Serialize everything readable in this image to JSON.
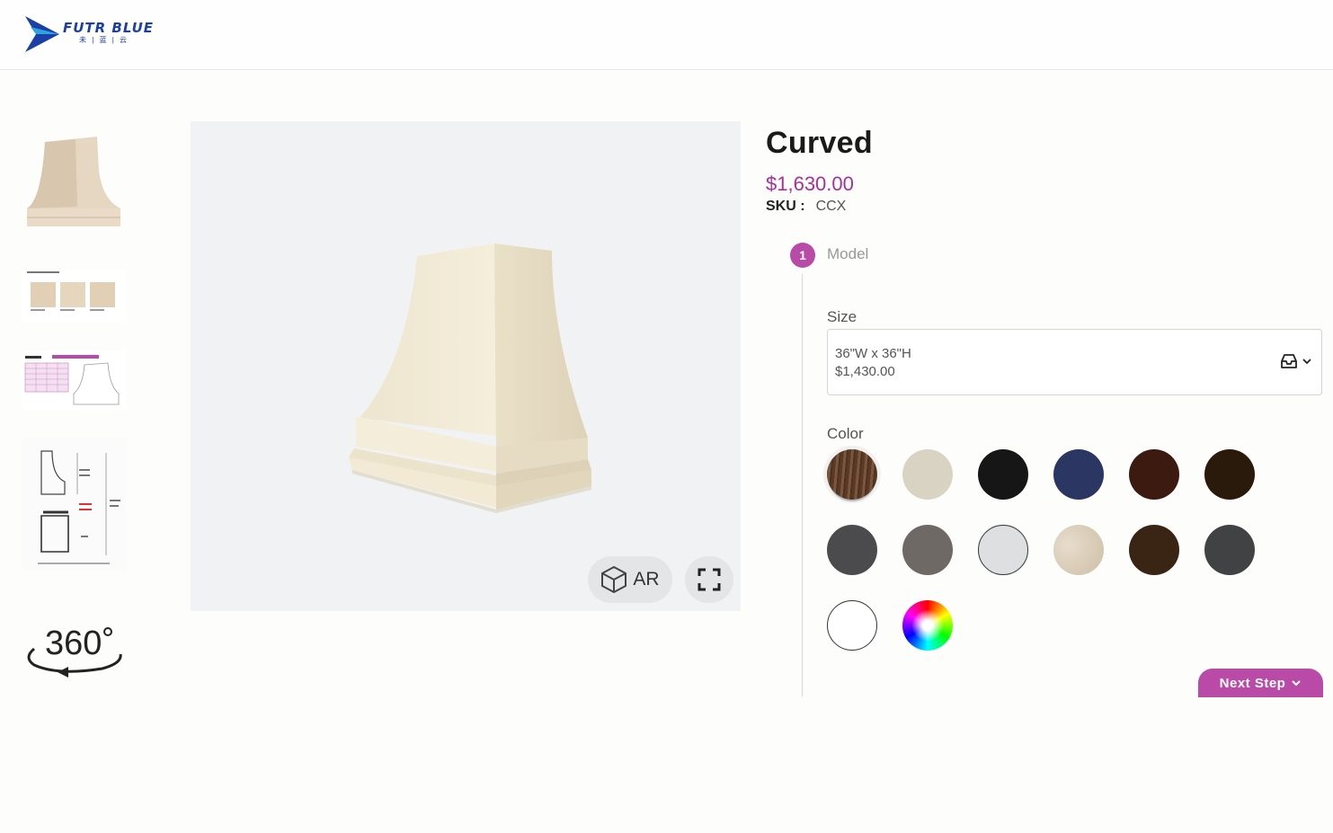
{
  "brand": {
    "name": "FUTR BLUE",
    "subtitle": "未 | 蓝 | 云",
    "color": "#1a3fa8"
  },
  "thumbnails": [
    {
      "name": "hood-front-thumbnail",
      "icon": "hood-image"
    },
    {
      "name": "hood-types-thumbnail",
      "icon": "types-diagram",
      "text": "Types Of Our Ah Hds"
    },
    {
      "name": "curved-spec-thumbnail",
      "icon": "spec-sheet",
      "text": "Curved"
    },
    {
      "name": "dimension-diagram-thumbnail",
      "icon": "dimension-diagram"
    },
    {
      "name": "view-360-button",
      "icon": "rotate-360-icon",
      "text": "360°"
    }
  ],
  "viewer": {
    "ar_label": "AR",
    "ar_icon": "cube-icon",
    "fullscreen_icon": "fullscreen-icon"
  },
  "product": {
    "title": "Curved",
    "price": "$1,630.00",
    "sku_label": "SKU :",
    "sku_value": "CCX"
  },
  "step": {
    "number": "1",
    "label": "Model"
  },
  "size": {
    "label": "Size",
    "selected_dims": "36\"W x 36\"H",
    "selected_price": "$1,430.00",
    "icons": [
      "inbox-icon",
      "chevron-down-icon"
    ]
  },
  "color": {
    "label": "Color",
    "swatches": [
      {
        "name": "walnut-wood",
        "color": "#6b4a33",
        "selected": true
      },
      {
        "name": "cream",
        "color": "#d9d3c3"
      },
      {
        "name": "black",
        "color": "#161616"
      },
      {
        "name": "navy",
        "color": "#2c3663"
      },
      {
        "name": "mahogany",
        "color": "#3c1a10"
      },
      {
        "name": "espresso",
        "color": "#2a1a0c"
      },
      {
        "name": "charcoal",
        "color": "#4b4b4d"
      },
      {
        "name": "taupe-gray",
        "color": "#6f6966"
      },
      {
        "name": "light-gray",
        "color": "#dedfe0"
      },
      {
        "name": "stone-beige",
        "color": "#d8cbb6"
      },
      {
        "name": "dark-brown",
        "color": "#3a2414"
      },
      {
        "name": "graphite",
        "color": "#414244"
      },
      {
        "name": "white",
        "color": "#ffffff"
      },
      {
        "name": "custom-color-wheel",
        "color": "rainbow"
      }
    ]
  },
  "next_button": {
    "label": "Next Step",
    "icon": "chevron-down-icon",
    "color": "#b94aa7"
  }
}
